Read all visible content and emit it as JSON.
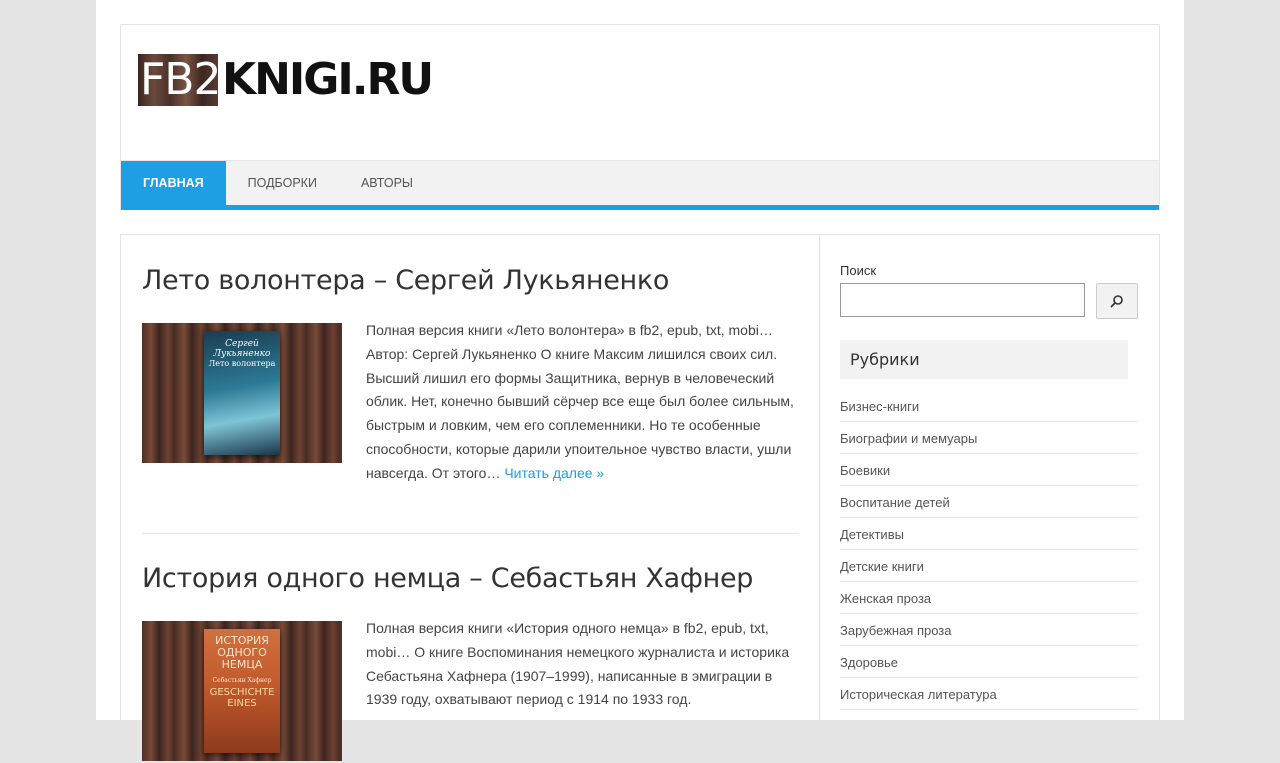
{
  "site": {
    "logo_part1": "FB2",
    "logo_part2": "KNIGI.RU"
  },
  "nav": [
    {
      "label": "ГЛАВНАЯ",
      "active": true
    },
    {
      "label": "ПОДБОРКИ",
      "active": false
    },
    {
      "label": "АВТОРЫ",
      "active": false
    }
  ],
  "posts": [
    {
      "title": "Лето волонтера – Сергей Лукьяненко",
      "cover_author": "Сергей Лукьяненко",
      "cover_title": "Лето волонтера",
      "excerpt": "Полная версия книги «Лето волонтера» в fb2, epub, txt, mobi… Автор: Сергей Лукьяненко О книге Максим лишился своих сил. Высший лишил его формы Защитника, вернув в человеческий облик. Нет, конечно бывший сёрчер все еще был более сильным, быстрым и ловким, чем его соплеменники. Но те особенные способности, которые дарили упоительное чувство власти, ушли навсегда. От этого…",
      "read_more": "Читать далее »"
    },
    {
      "title": "История одного немца – Себастьян Хафнер",
      "cover_title": "История одного немца",
      "cover_author": "Себастьян Хафнер",
      "cover_subtitle": "Geschichte eines",
      "excerpt": "Полная версия книги «История одного немца» в fb2, epub, txt, mobi… О книге Воспоминания немецкого журналиста и историка Себастьяна Хафнера (1907–1999), написанные в эмиграции в 1939 году, охватывают период с 1914 по 1933 год."
    }
  ],
  "sidebar": {
    "search_label": "Поиск",
    "search_value": "",
    "categories_title": "Рубрики",
    "categories": [
      "Бизнес-книги",
      "Биографии и мемуары",
      "Боевики",
      "Воспитание детей",
      "Детективы",
      "Детские книги",
      "Женская проза",
      "Зарубежная проза",
      "Здоровье",
      "Историческая литература"
    ]
  },
  "colors": {
    "accent": "#1e9ee4",
    "background": "#e5e5e5",
    "nav_background": "#f2f2f2"
  }
}
